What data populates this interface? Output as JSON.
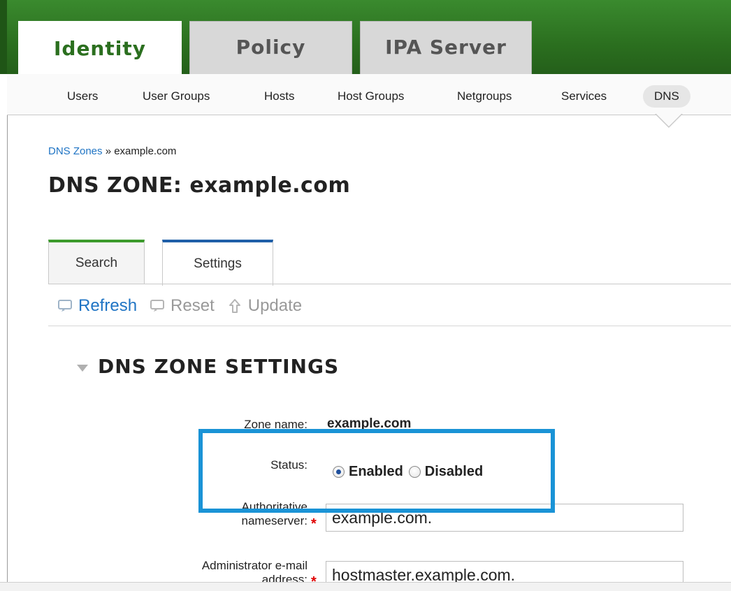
{
  "main_tabs": [
    {
      "label": "Identity",
      "active": true
    },
    {
      "label": "Policy",
      "active": false
    },
    {
      "label": "IPA Server",
      "active": false
    }
  ],
  "subnav": {
    "items": [
      "Users",
      "User Groups",
      "Hosts",
      "Host Groups",
      "Netgroups",
      "Services",
      "DNS"
    ],
    "active": "DNS"
  },
  "breadcrumb": {
    "link": "DNS Zones",
    "separator": "»",
    "current": "example.com"
  },
  "page_title": "DNS ZONE: example.com",
  "facet_tabs": [
    {
      "label": "Search",
      "active": false,
      "accent": "#3c9a2c"
    },
    {
      "label": "Settings",
      "active": true,
      "accent": "#1f5fa8"
    }
  ],
  "actions": [
    {
      "label": "Refresh",
      "icon": "refresh-icon",
      "enabled": true
    },
    {
      "label": "Reset",
      "icon": "reset-icon",
      "enabled": false
    },
    {
      "label": "Update",
      "icon": "update-arrow-icon",
      "enabled": false
    }
  ],
  "section": {
    "title": "DNS ZONE SETTINGS",
    "collapsed": false
  },
  "form": {
    "zone_name": {
      "label": "Zone name:",
      "value": "example.com"
    },
    "status": {
      "label": "Status:",
      "options": [
        "Enabled",
        "Disabled"
      ],
      "selected": "Enabled"
    },
    "auth_ns": {
      "label_line1": "Authoritative",
      "label_line2": "nameserver:",
      "required_mark": "*",
      "value": "example.com."
    },
    "admin_email": {
      "label_line1": "Administrator e-mail",
      "label_line2": "address:",
      "required_mark": "*",
      "value": "hostmaster.example.com."
    }
  },
  "colors": {
    "brand_green": "#2b6f1f",
    "link_blue": "#1f74c4",
    "highlight_blue": "#1a93d6",
    "required_red": "#e00000"
  }
}
